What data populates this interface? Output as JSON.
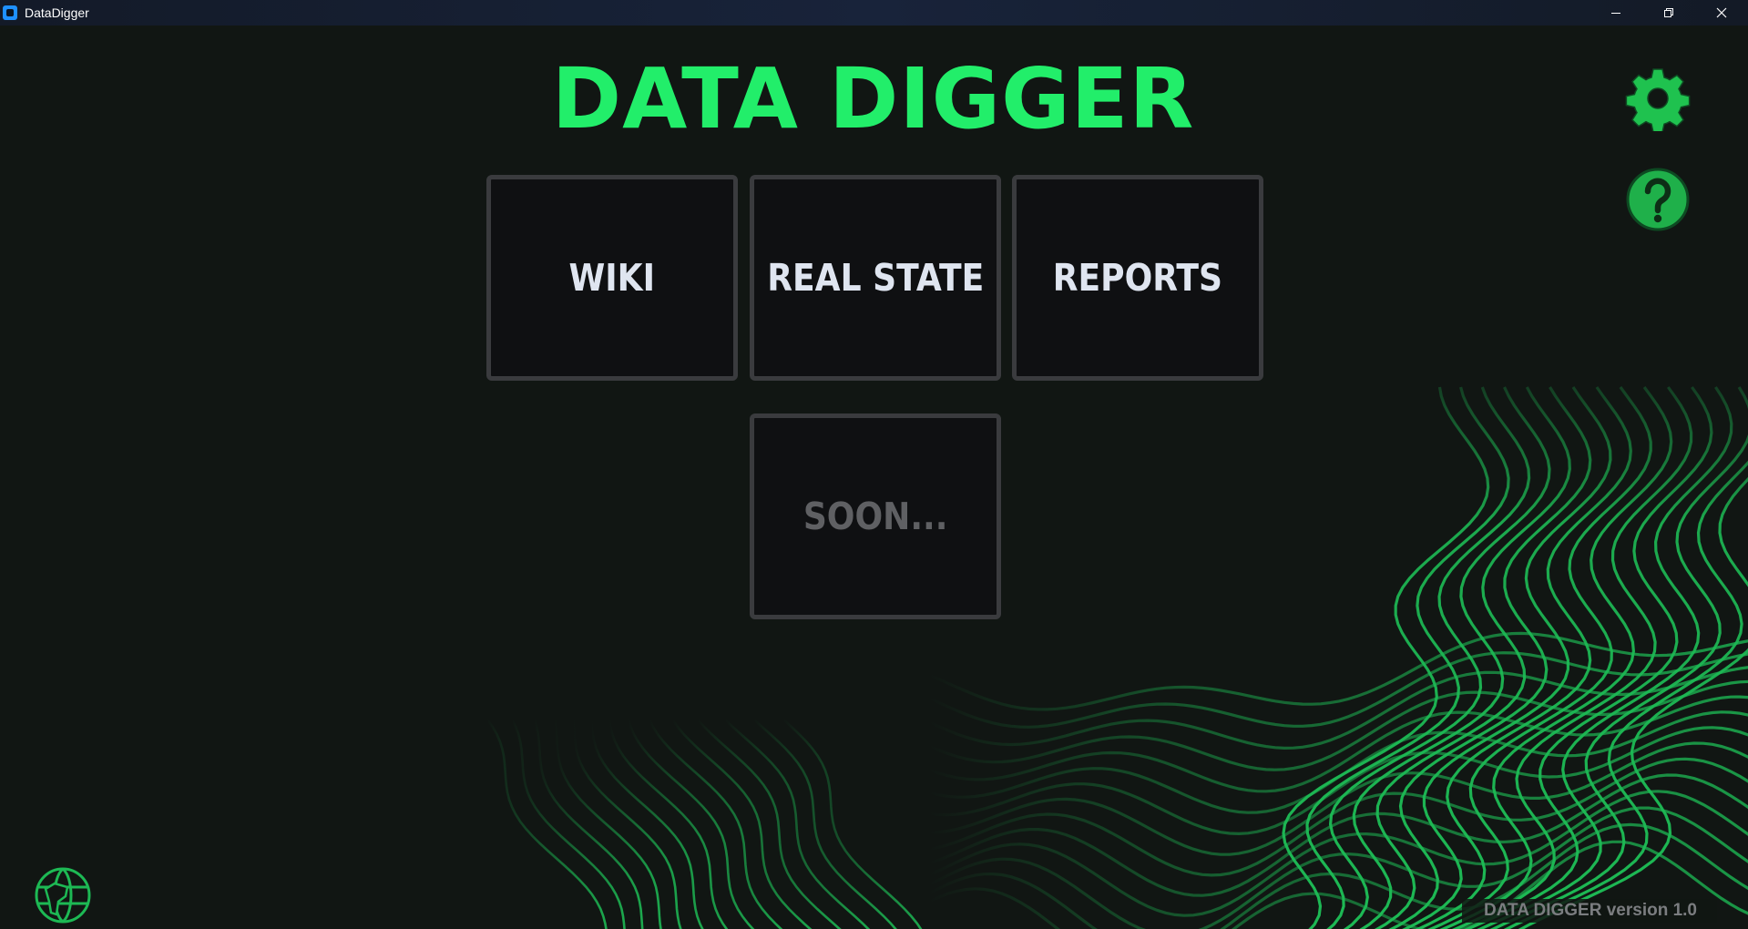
{
  "window": {
    "title": "DataDigger",
    "icon": "app-icon"
  },
  "header": {
    "title": "DATA DIGGER"
  },
  "tiles": [
    {
      "label": "WIKI",
      "enabled": true
    },
    {
      "label": "REAL STATE",
      "enabled": true
    },
    {
      "label": "REPORTS",
      "enabled": true
    },
    {
      "label": "SOON...",
      "enabled": false
    }
  ],
  "side_icons": {
    "settings": "gear-icon",
    "help": "help-icon",
    "language": "globe-icon"
  },
  "footer": {
    "version": "DATA DIGGER version 1.0"
  },
  "colors": {
    "accent": "#22ee6a",
    "background": "#111613",
    "tile_background": "#0f1012",
    "tile_border": "#3a3b3e",
    "tile_text": "#dfe5f0",
    "disabled_text": "#5f6063"
  }
}
